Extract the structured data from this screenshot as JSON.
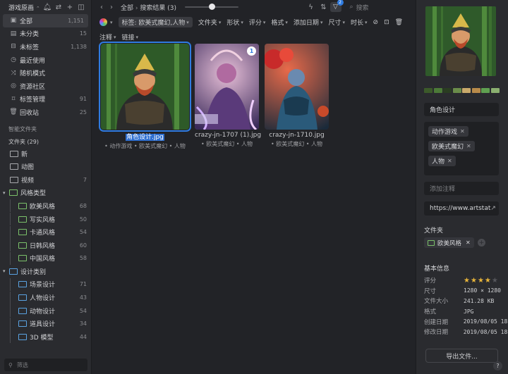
{
  "sidebar": {
    "library": "游戏原画",
    "library_chevron": "⌃",
    "items": [
      {
        "icon": "all-icon",
        "glyph": "▣",
        "label": "全部",
        "count": "1,151"
      },
      {
        "icon": "uncategorized-icon",
        "glyph": "▤",
        "label": "未分类",
        "count": "15"
      },
      {
        "icon": "untagged-icon",
        "glyph": "⊟",
        "label": "未标签",
        "count": "1,138"
      },
      {
        "icon": "recent-icon",
        "glyph": "◷",
        "label": "最近使用",
        "count": ""
      },
      {
        "icon": "shuffle-icon",
        "glyph": "⤨",
        "label": "随机模式",
        "count": ""
      },
      {
        "icon": "community-icon",
        "glyph": "◎",
        "label": "资源社区",
        "count": ""
      },
      {
        "icon": "tag-manage-icon",
        "glyph": "⌑",
        "label": "标签管理",
        "count": "91"
      },
      {
        "icon": "trash-icon",
        "glyph": "🗑",
        "label": "回收站",
        "count": "25"
      }
    ],
    "smart_folders": "智能文件夹",
    "folders_header": "文件夹 (29)",
    "folders": [
      {
        "label": "新",
        "count": "",
        "color": "plain"
      },
      {
        "label": "动图",
        "count": "",
        "color": "plain"
      },
      {
        "label": "视频",
        "count": "7",
        "color": "plain"
      }
    ],
    "groups": [
      {
        "label": "风格类型",
        "color": "g",
        "children": [
          {
            "label": "欧美风格",
            "count": "68"
          },
          {
            "label": "写实风格",
            "count": "50"
          },
          {
            "label": "卡通风格",
            "count": "54"
          },
          {
            "label": "日韩风格",
            "count": "60"
          },
          {
            "label": "中国风格",
            "count": "58"
          }
        ]
      },
      {
        "label": "设计类别",
        "color": "b",
        "children": [
          {
            "label": "场景设计",
            "count": "71"
          },
          {
            "label": "人物设计",
            "count": "43"
          },
          {
            "label": "动物设计",
            "count": "54"
          },
          {
            "label": "道具设计",
            "count": "34"
          },
          {
            "label": "3D 模型",
            "count": "44"
          }
        ]
      }
    ],
    "filter_placeholder": "筛选"
  },
  "toolbar": {
    "crumb_root": "全部",
    "crumb_sep": "›",
    "crumb_current": "搜索结果 (3)",
    "filter_badge": "2",
    "search_placeholder": "搜索"
  },
  "filters": {
    "tag_filter": "标签: 欧美式魔幻,人物",
    "items": [
      "文件夹",
      "形状",
      "评分",
      "格式",
      "添加日期",
      "尺寸",
      "时长"
    ],
    "row2": [
      "注释",
      "链接"
    ]
  },
  "cards": [
    {
      "name": "角色设计.jpg",
      "tags": "• 动作游戏  • 欧美式魔幻  • 人物",
      "active": true,
      "badge": ""
    },
    {
      "name": "crazy-jn-1707 (1).jpg",
      "tags": "• 欧美式魔幻  • 人物",
      "active": false,
      "badge": "1"
    },
    {
      "name": "crazy-jn-1710.jpg",
      "tags": "• 欧美式魔幻  • 人物",
      "active": false,
      "badge": ""
    }
  ],
  "inspector": {
    "palette": [
      "#3c5a2a",
      "#4c7a38",
      "#2a3d21",
      "#6a8c4a",
      "#c9a96a",
      "#b88a4a",
      "#5fa050",
      "#8bb070"
    ],
    "title": "角色设计",
    "tags": [
      "动作游戏",
      "欧美式魔幻",
      "人物"
    ],
    "note_placeholder": "添加注释",
    "url": "https://www.artstat",
    "folder_label": "文件夹",
    "folder": "欧美风格",
    "basic_info": "基本信息",
    "rating_label": "评分",
    "rating": 4,
    "rating_max": 5,
    "info": [
      {
        "k": "尺寸",
        "v": "1280 × 1280"
      },
      {
        "k": "文件大小",
        "v": "241.28 KB"
      },
      {
        "k": "格式",
        "v": "JPG"
      },
      {
        "k": "创建日期",
        "v": "2019/08/05 18"
      },
      {
        "k": "修改日期",
        "v": "2019/08/05 18"
      }
    ],
    "export": "导出文件...",
    "help": "?"
  }
}
